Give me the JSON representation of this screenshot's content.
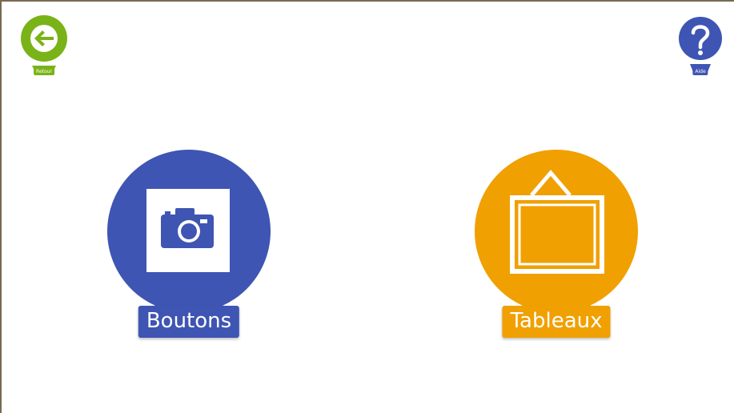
{
  "header": {
    "back": {
      "label": "Retour",
      "icon": "arrow-left-icon",
      "color": "#7ab317"
    },
    "help": {
      "label": "Aide",
      "icon": "question-mark-icon",
      "color": "#3f55b3"
    }
  },
  "menu": {
    "items": [
      {
        "label": "Boutons",
        "icon": "camera-icon",
        "color": "#3f55b3"
      },
      {
        "label": "Tableaux",
        "icon": "picture-frame-icon",
        "color": "#f0a000"
      }
    ]
  }
}
